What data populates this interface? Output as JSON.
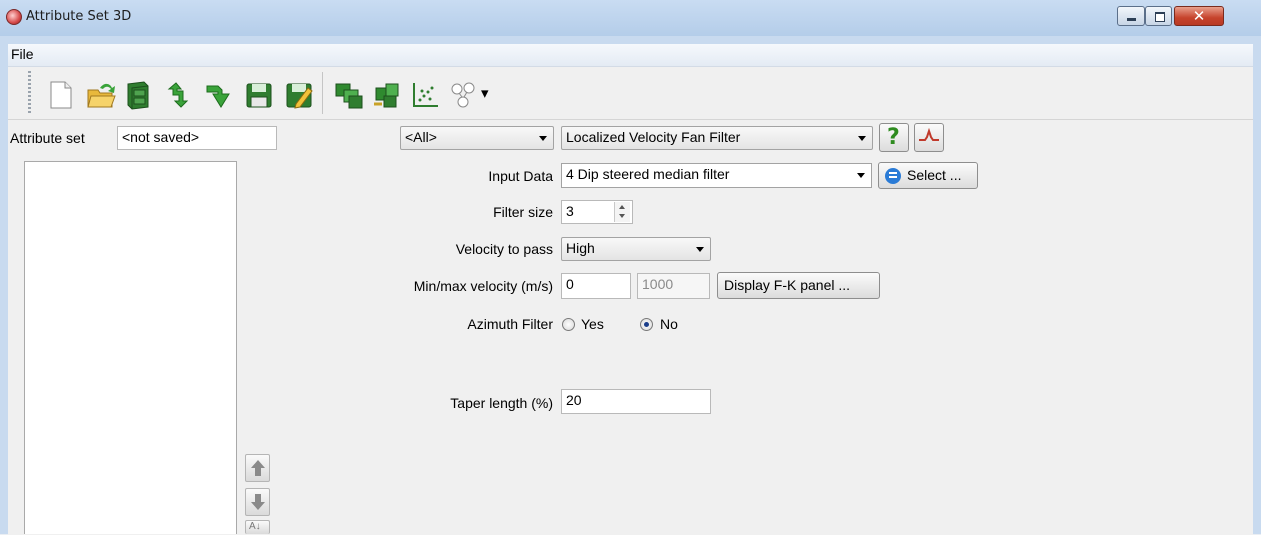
{
  "window": {
    "title": "Attribute Set 3D",
    "close_glyph": "✕"
  },
  "menu": {
    "file": "File"
  },
  "toolbar": {
    "icons": [
      "new-icon",
      "open-icon",
      "cabinet-icon",
      "import-icon",
      "reimport-icon",
      "save-icon",
      "save-as-icon",
      "auto-attribute-icon",
      "auto-2d-icon",
      "crossplot-icon",
      "evaluate-icon"
    ],
    "more_arrow": "▾"
  },
  "attribute_set": {
    "label": "Attribute set",
    "value": "<not saved>"
  },
  "filter_combo": {
    "value": "<All>"
  },
  "attribute_combo": {
    "value": "Localized Velocity Fan Filter"
  },
  "help_button": {
    "label": "?"
  },
  "form": {
    "input_data": {
      "label": "Input Data",
      "value": "4 Dip steered median filter",
      "select_label": "Select ..."
    },
    "filter_size": {
      "label": "Filter size",
      "value": "3"
    },
    "velocity_to_pass": {
      "label": "Velocity to pass",
      "value": "High"
    },
    "minmax_velocity": {
      "label": "Min/max velocity (m/s)",
      "min": "0",
      "max": "1000",
      "fk_button": "Display F-K panel ..."
    },
    "azimuth_filter": {
      "label": "Azimuth Filter",
      "yes": "Yes",
      "no": "No",
      "selected": "No"
    },
    "taper_length": {
      "label": "Taper length (%)",
      "value": "20"
    }
  },
  "side_buttons": {
    "bottom_label": "A↓"
  },
  "colors": {
    "titlebar": "#b4cde9",
    "close_button": "#c6432c",
    "panel": "#f0f0f0",
    "help_icon": "#2e8b1f"
  }
}
